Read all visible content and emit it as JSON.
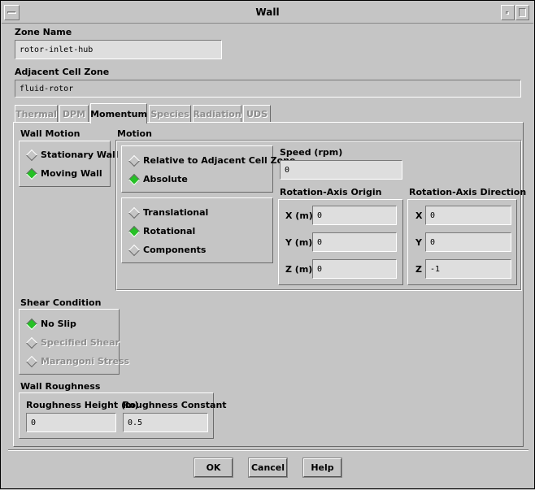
{
  "window": {
    "title": "Wall"
  },
  "zone_name": {
    "label": "Zone Name",
    "value": "rotor-inlet-hub"
  },
  "adjacent_cell_zone": {
    "label": "Adjacent Cell Zone",
    "value": "fluid-rotor"
  },
  "tabs": [
    {
      "label": "Thermal",
      "state": "disabled"
    },
    {
      "label": "DPM",
      "state": "disabled"
    },
    {
      "label": "Momentum",
      "state": "active"
    },
    {
      "label": "Species",
      "state": "disabled"
    },
    {
      "label": "Radiation",
      "state": "disabled"
    },
    {
      "label": "UDS",
      "state": "disabled"
    }
  ],
  "wall_motion": {
    "label": "Wall Motion",
    "options": [
      {
        "label": "Stationary Wall",
        "selected": false
      },
      {
        "label": "Moving Wall",
        "selected": true
      }
    ]
  },
  "motion": {
    "label": "Motion",
    "reference": [
      {
        "label": "Relative to Adjacent Cell Zone",
        "selected": false
      },
      {
        "label": "Absolute",
        "selected": true
      }
    ],
    "type": [
      {
        "label": "Translational",
        "selected": false
      },
      {
        "label": "Rotational",
        "selected": true
      },
      {
        "label": "Components",
        "selected": false
      }
    ],
    "speed": {
      "label": "Speed (rpm)",
      "value": "0"
    },
    "axis_origin": {
      "label": "Rotation-Axis Origin",
      "x_label": "X (m)",
      "x": "0",
      "y_label": "Y (m)",
      "y": "0",
      "z_label": "Z (m)",
      "z": "0"
    },
    "axis_direction": {
      "label": "Rotation-Axis Direction",
      "x_label": "X",
      "x": "0",
      "y_label": "Y",
      "y": "0",
      "z_label": "Z",
      "z": "-1"
    }
  },
  "shear_condition": {
    "label": "Shear Condition",
    "options": [
      {
        "label": "No Slip",
        "selected": true,
        "enabled": true
      },
      {
        "label": "Specified Shear",
        "selected": false,
        "enabled": false
      },
      {
        "label": "Marangoni Stress",
        "selected": false,
        "enabled": false
      }
    ]
  },
  "wall_roughness": {
    "label": "Wall Roughness",
    "height": {
      "label": "Roughness Height (m)",
      "value": "0"
    },
    "constant": {
      "label": "Roughness Constant",
      "value": "0.5"
    }
  },
  "buttons": {
    "ok": "OK",
    "cancel": "Cancel",
    "help": "Help"
  },
  "colors": {
    "background": "#c5c5c5",
    "radio_selected": "#25c025",
    "field": "#dedede"
  }
}
